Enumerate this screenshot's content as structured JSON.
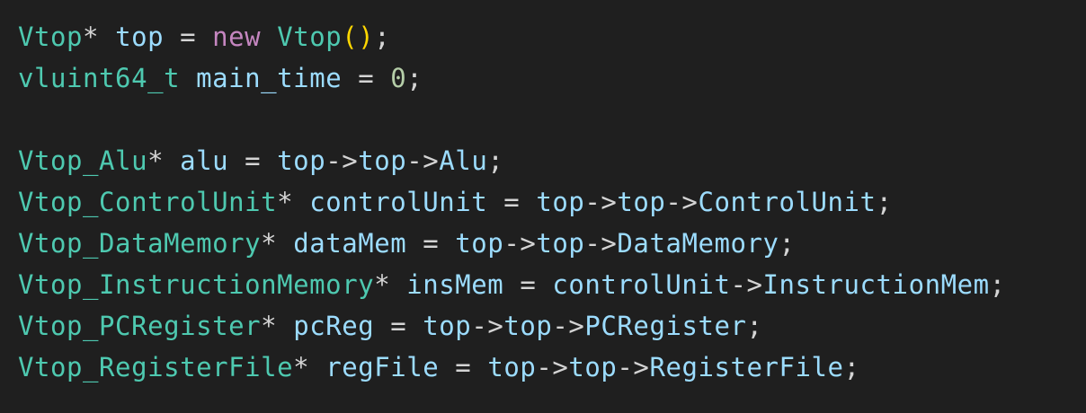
{
  "colors": {
    "background": "#1f1f1f",
    "type": "#4ec9b0",
    "variable": "#9cdcfe",
    "operator": "#d4d4d4",
    "keyword": "#c586c0",
    "number": "#b5cea8",
    "bracket": "#ffd700"
  },
  "lines": [
    [
      {
        "t": "Vtop",
        "k": "type"
      },
      {
        "t": "* ",
        "k": "op"
      },
      {
        "t": "top",
        "k": "var"
      },
      {
        "t": " = ",
        "k": "op"
      },
      {
        "t": "new",
        "k": "kw"
      },
      {
        "t": " ",
        "k": "op"
      },
      {
        "t": "Vtop",
        "k": "type"
      },
      {
        "t": "()",
        "k": "paren"
      },
      {
        "t": ";",
        "k": "op"
      }
    ],
    [
      {
        "t": "vluint64_t",
        "k": "type"
      },
      {
        "t": " ",
        "k": "op"
      },
      {
        "t": "main_time",
        "k": "var"
      },
      {
        "t": " = ",
        "k": "op"
      },
      {
        "t": "0",
        "k": "num"
      },
      {
        "t": ";",
        "k": "op"
      }
    ],
    [],
    [
      {
        "t": "Vtop_Alu",
        "k": "type"
      },
      {
        "t": "* ",
        "k": "op"
      },
      {
        "t": "alu",
        "k": "var"
      },
      {
        "t": " = ",
        "k": "op"
      },
      {
        "t": "top",
        "k": "var"
      },
      {
        "t": "->",
        "k": "op"
      },
      {
        "t": "top",
        "k": "var"
      },
      {
        "t": "->",
        "k": "op"
      },
      {
        "t": "Alu",
        "k": "var"
      },
      {
        "t": ";",
        "k": "op"
      }
    ],
    [
      {
        "t": "Vtop_ControlUnit",
        "k": "type"
      },
      {
        "t": "* ",
        "k": "op"
      },
      {
        "t": "controlUnit",
        "k": "var"
      },
      {
        "t": " = ",
        "k": "op"
      },
      {
        "t": "top",
        "k": "var"
      },
      {
        "t": "->",
        "k": "op"
      },
      {
        "t": "top",
        "k": "var"
      },
      {
        "t": "->",
        "k": "op"
      },
      {
        "t": "ControlUnit",
        "k": "var"
      },
      {
        "t": ";",
        "k": "op"
      }
    ],
    [
      {
        "t": "Vtop_DataMemory",
        "k": "type"
      },
      {
        "t": "* ",
        "k": "op"
      },
      {
        "t": "dataMem",
        "k": "var"
      },
      {
        "t": " = ",
        "k": "op"
      },
      {
        "t": "top",
        "k": "var"
      },
      {
        "t": "->",
        "k": "op"
      },
      {
        "t": "top",
        "k": "var"
      },
      {
        "t": "->",
        "k": "op"
      },
      {
        "t": "DataMemory",
        "k": "var"
      },
      {
        "t": ";",
        "k": "op"
      }
    ],
    [
      {
        "t": "Vtop_InstructionMemory",
        "k": "type"
      },
      {
        "t": "* ",
        "k": "op"
      },
      {
        "t": "insMem",
        "k": "var"
      },
      {
        "t": " = ",
        "k": "op"
      },
      {
        "t": "controlUnit",
        "k": "var"
      },
      {
        "t": "->",
        "k": "op"
      },
      {
        "t": "InstructionMem",
        "k": "var"
      },
      {
        "t": ";",
        "k": "op"
      }
    ],
    [
      {
        "t": "Vtop_PCRegister",
        "k": "type"
      },
      {
        "t": "* ",
        "k": "op"
      },
      {
        "t": "pcReg",
        "k": "var"
      },
      {
        "t": " = ",
        "k": "op"
      },
      {
        "t": "top",
        "k": "var"
      },
      {
        "t": "->",
        "k": "op"
      },
      {
        "t": "top",
        "k": "var"
      },
      {
        "t": "->",
        "k": "op"
      },
      {
        "t": "PCRegister",
        "k": "var"
      },
      {
        "t": ";",
        "k": "op"
      }
    ],
    [
      {
        "t": "Vtop_RegisterFile",
        "k": "type"
      },
      {
        "t": "* ",
        "k": "op"
      },
      {
        "t": "regFile",
        "k": "var"
      },
      {
        "t": " = ",
        "k": "op"
      },
      {
        "t": "top",
        "k": "var"
      },
      {
        "t": "->",
        "k": "op"
      },
      {
        "t": "top",
        "k": "var"
      },
      {
        "t": "->",
        "k": "op"
      },
      {
        "t": "RegisterFile",
        "k": "var"
      },
      {
        "t": ";",
        "k": "op"
      }
    ]
  ]
}
